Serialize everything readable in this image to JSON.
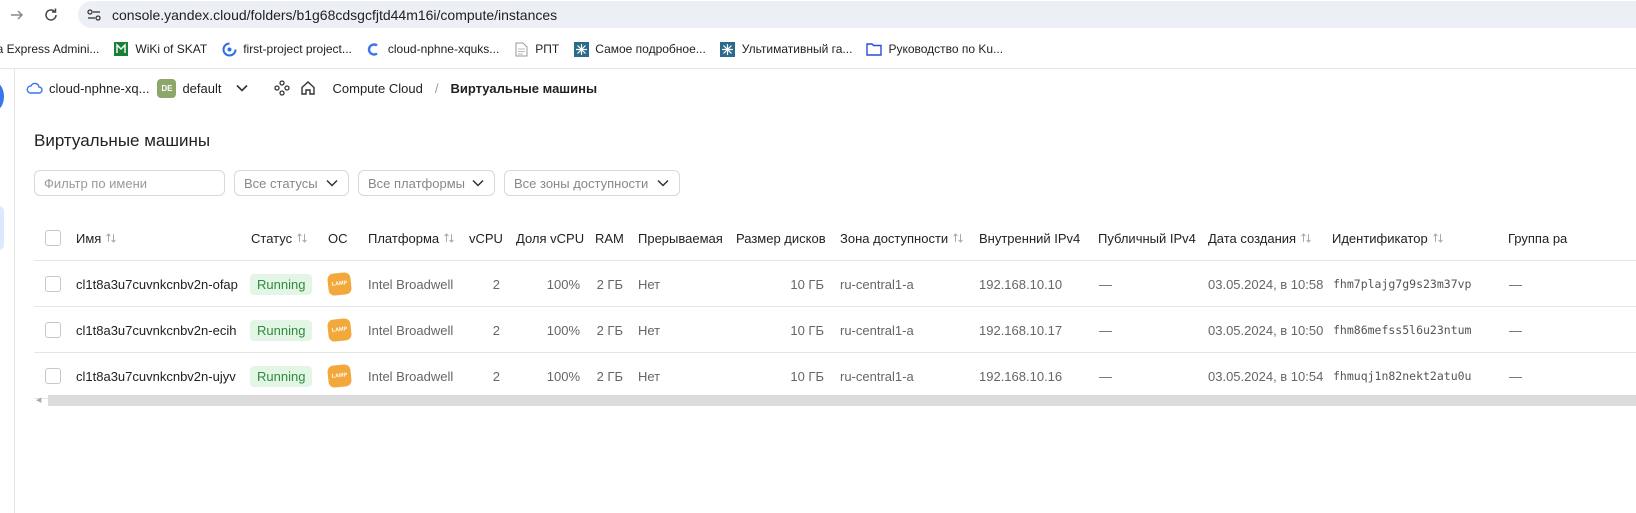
{
  "browser": {
    "url": "console.yandex.cloud/folders/b1g68cdsgcfjtd44m16i/compute/instances",
    "bookmarks": [
      {
        "label": "ea Express Admini...",
        "icon": "none"
      },
      {
        "label": "WiKi of SKAT",
        "icon": "wiki-icon"
      },
      {
        "label": "first-project project...",
        "icon": "project-icon"
      },
      {
        "label": "cloud-nphne-xquks...",
        "icon": "cloud-icon"
      },
      {
        "label": "РПТ",
        "icon": "doc-icon"
      },
      {
        "label": "Самое подробное...",
        "icon": "snowflake-icon"
      },
      {
        "label": "Ультимативный га...",
        "icon": "snowflake-icon"
      },
      {
        "label": "Руководство по Ku...",
        "icon": "folder-icon"
      }
    ]
  },
  "topbar": {
    "cloud_name": "cloud-nphne-xq...",
    "folder_badge": "DE",
    "folder_name": "default",
    "breadcrumb_service": "Compute Cloud",
    "breadcrumb_separator": "/",
    "breadcrumb_current": "Виртуальные машины"
  },
  "page": {
    "title": "Виртуальные машины"
  },
  "filters": {
    "name_placeholder": "Фильтр по имени",
    "status": "Все статусы",
    "platform": "Все платформы",
    "zone": "Все зоны доступности"
  },
  "table": {
    "columns": {
      "name": "Имя",
      "status": "Статус",
      "os": "ОС",
      "platform": "Платформа",
      "vcpu": "vCPU",
      "vcpu_share": "Доля vCPU",
      "ram": "RAM",
      "preemptible": "Прерываемая",
      "disk_size": "Размер дисков",
      "zone": "Зона доступности",
      "internal_ip": "Внутренний IPv4",
      "public_ip": "Публичный IPv4",
      "created": "Дата создания",
      "id": "Идентификатор",
      "group": "Группа ра"
    },
    "rows": [
      {
        "name": "cl1t8a3u7cuvnkcnbv2n-ofap",
        "status": "Running",
        "os": "LAMP",
        "platform": "Intel Broadwell",
        "vcpu": "2",
        "vcpu_share": "100%",
        "ram": "2 ГБ",
        "preemptible": "Нет",
        "disk_size": "10 ГБ",
        "zone": "ru-central1-a",
        "internal_ip": "192.168.10.10",
        "public_ip": "—",
        "created": "03.05.2024, в 10:58",
        "id": "fhm7plajg7g9s23m37vp",
        "group": "—"
      },
      {
        "name": "cl1t8a3u7cuvnkcnbv2n-ecih",
        "status": "Running",
        "os": "LAMP",
        "platform": "Intel Broadwell",
        "vcpu": "2",
        "vcpu_share": "100%",
        "ram": "2 ГБ",
        "preemptible": "Нет",
        "disk_size": "10 ГБ",
        "zone": "ru-central1-a",
        "internal_ip": "192.168.10.17",
        "public_ip": "—",
        "created": "03.05.2024, в 10:50",
        "id": "fhm86mefss5l6u23ntum",
        "group": "—"
      },
      {
        "name": "cl1t8a3u7cuvnkcnbv2n-ujyv",
        "status": "Running",
        "os": "LAMP",
        "platform": "Intel Broadwell",
        "vcpu": "2",
        "vcpu_share": "100%",
        "ram": "2 ГБ",
        "preemptible": "Нет",
        "disk_size": "10 ГБ",
        "zone": "ru-central1-a",
        "internal_ip": "192.168.10.16",
        "public_ip": "—",
        "created": "03.05.2024, в 10:54",
        "id": "fhmuqj1n82nekt2atu0u",
        "group": "—"
      }
    ]
  },
  "colors": {
    "running_bg": "#e3f5e5",
    "running_fg": "#2f8b3c",
    "lamp_badge": "#f3a83b",
    "folder_badge": "#8da66a",
    "accent": "#3a76f0"
  }
}
